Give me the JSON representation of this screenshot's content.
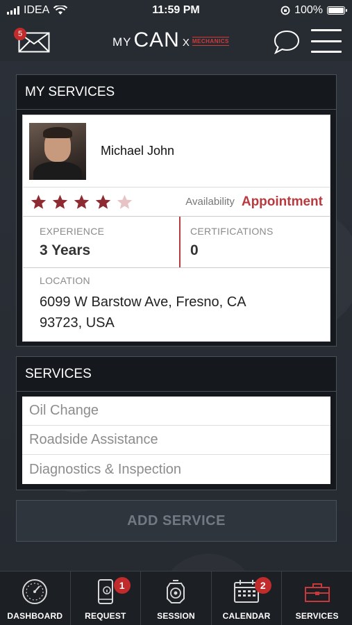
{
  "status_bar": {
    "carrier": "IDEA",
    "time": "11:59 PM",
    "battery": "100%"
  },
  "header": {
    "mail_badge": "5",
    "logo": {
      "my": "MY",
      "can": "CAN",
      "x": "X",
      "mechanics": "MECHANICS"
    }
  },
  "profile_panel": {
    "title": "MY SERVICES",
    "name": "Michael John",
    "rating": 4,
    "rating_max": 5,
    "availability_label": "Availability",
    "availability_value": "Appointment",
    "experience_label": "EXPERIENCE",
    "experience_value": "3 Years",
    "certifications_label": "CERTIFICATIONS",
    "certifications_value": "0",
    "location_label": "LOCATION",
    "location_line1": "6099 W Barstow Ave, Fresno, CA",
    "location_line2": "93723, USA"
  },
  "services_panel": {
    "title": "SERVICES",
    "items": [
      "Oil Change",
      "Roadside Assistance",
      "Diagnostics & Inspection"
    ]
  },
  "add_service_label": "ADD SERVICE",
  "tabs": [
    {
      "label": "DASHBOARD",
      "icon": "speedometer-icon",
      "badge": null
    },
    {
      "label": "REQUEST",
      "icon": "phone-info-icon",
      "badge": "1"
    },
    {
      "label": "SESSION",
      "icon": "engine-icon",
      "badge": null
    },
    {
      "label": "CALENDAR",
      "icon": "calendar-icon",
      "badge": "2"
    },
    {
      "label": "SERVICES",
      "icon": "toolbox-icon",
      "badge": null,
      "active": true
    }
  ],
  "colors": {
    "accent": "#b83a3f",
    "badge": "#c22b2b",
    "background": "#2a2f36",
    "panel": "#15181c"
  }
}
